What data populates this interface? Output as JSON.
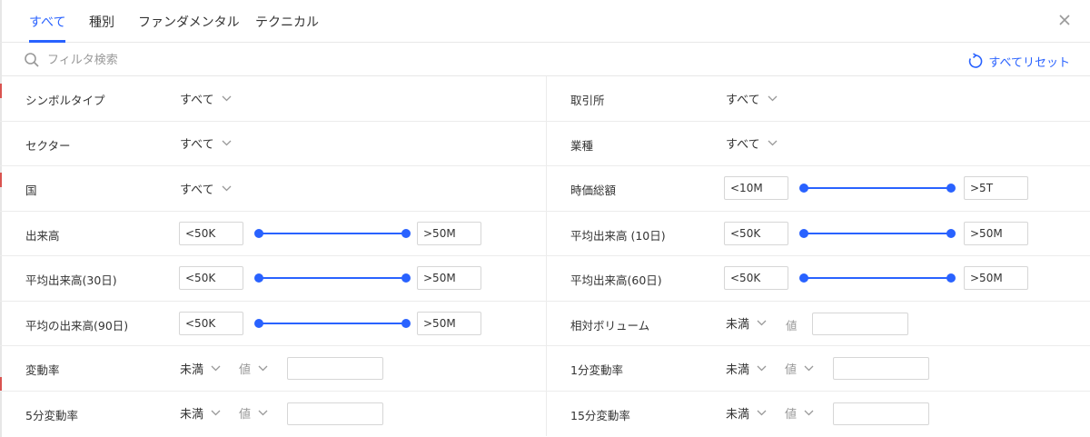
{
  "tabs": [
    {
      "label": "すべて",
      "active": true
    },
    {
      "label": "種別",
      "active": false
    },
    {
      "label": "ファンダメンタル",
      "active": false
    },
    {
      "label": "テクニカル",
      "active": false
    }
  ],
  "search": {
    "placeholder": "フィルタ検索"
  },
  "reset_label": "すべてリセット",
  "colors": {
    "accent": "#2962ff",
    "border": "#ececec",
    "muted": "#999999"
  },
  "filters": {
    "symbol_type": {
      "label": "シンボルタイプ",
      "value": "すべて"
    },
    "exchange": {
      "label": "取引所",
      "value": "すべて"
    },
    "sector": {
      "label": "セクター",
      "value": "すべて"
    },
    "industry": {
      "label": "業種",
      "value": "すべて"
    },
    "country": {
      "label": "国",
      "value": "すべて"
    },
    "market_cap": {
      "label": "時価総額",
      "min": "<10M",
      "max": ">5T"
    },
    "volume": {
      "label": "出来高",
      "min": "<50K",
      "max": ">50M"
    },
    "avg_volume_10d": {
      "label": "平均出来高 (10日)",
      "min": "<50K",
      "max": ">50M"
    },
    "avg_volume_30d": {
      "label": "平均出来高(30日)",
      "min": "<50K",
      "max": ">50M"
    },
    "avg_volume_60d": {
      "label": "平均出来高(60日)",
      "min": "<50K",
      "max": ">50M"
    },
    "avg_volume_90d": {
      "label": "平均の出来高(90日)",
      "min": "<50K",
      "max": ">50M"
    },
    "relative_volume": {
      "label": "相対ボリューム",
      "operator": "未満",
      "value_label": "値"
    },
    "change": {
      "label": "変動率",
      "operator": "未満",
      "value_label": "値"
    },
    "change_1m": {
      "label": "1分変動率",
      "operator": "未満",
      "value_label": "値"
    },
    "change_5m": {
      "label": "5分変動率",
      "operator": "未満",
      "value_label": "値"
    },
    "change_15m": {
      "label": "15分変動率",
      "operator": "未満",
      "value_label": "値"
    }
  }
}
